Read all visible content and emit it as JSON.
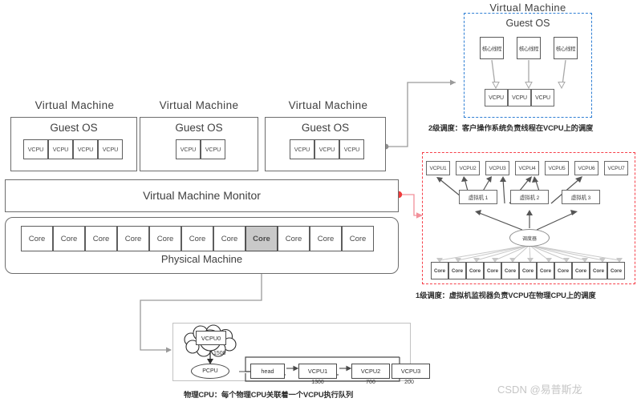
{
  "left_stack": {
    "vms": [
      {
        "title": "Virtual  Machine",
        "guest_os": "Guest OS",
        "vcpus": [
          "VCPU",
          "VCPU",
          "VCPU",
          "VCPU"
        ]
      },
      {
        "title": "Virtual  Machine",
        "guest_os": "Guest OS",
        "vcpus": [
          "VCPU",
          "VCPU"
        ]
      },
      {
        "title": "Virtual  Machine",
        "guest_os": "Guest OS",
        "vcpus": [
          "VCPU",
          "VCPU",
          "VCPU"
        ]
      }
    ],
    "vmm_label": "Virtual Machine Monitor",
    "physical_machine_label": "Physical Machine",
    "cores": [
      "Core",
      "Core",
      "Core",
      "Core",
      "Core",
      "Core",
      "Core",
      "Core",
      "Core",
      "Core",
      "Core"
    ],
    "highlighted_core_index": 7
  },
  "level2_panel": {
    "title": "Virtual  Machine",
    "guest_os": "Guest OS",
    "threads": [
      "核心线程",
      "核心线程",
      "核心线程"
    ],
    "vcpus": [
      "VCPU",
      "VCPU",
      "VCPU"
    ],
    "caption": "2级调度：客户操作系统负责线程在VCPU上的调度",
    "border_color": "#2f7fd4"
  },
  "level1_panel": {
    "vcpus": [
      "VCPU1",
      "VCPU2",
      "VCPU3",
      "VCPU4",
      "VCPU5",
      "VCPU6",
      "VCPU7"
    ],
    "vms": [
      "虚拟机 1",
      "虚拟机 2",
      "虚拟机 3"
    ],
    "scheduler": "调度器",
    "cores": [
      "Core",
      "Core",
      "Core",
      "Core",
      "Core",
      "Core",
      "Core",
      "Core",
      "Core",
      "Core",
      "Core"
    ],
    "caption": "1级调度：虚拟机监视器负责VCPU在物理CPU上的调度",
    "border_color": "#f6404a"
  },
  "pcpu_panel": {
    "vcpu0": "VCPU0",
    "vcpu0_value": "1500",
    "pcpu": "PCPU",
    "head": "head",
    "queue": [
      {
        "label": "VCPU1",
        "value": "1300"
      },
      {
        "label": "VCPU2",
        "value": "700"
      },
      {
        "label": "VCPU3",
        "value": "200"
      }
    ],
    "caption": "物理CPU：每个物理CPU关联着一个VCPU执行队列"
  },
  "watermark": "CSDN @易普斯龙"
}
